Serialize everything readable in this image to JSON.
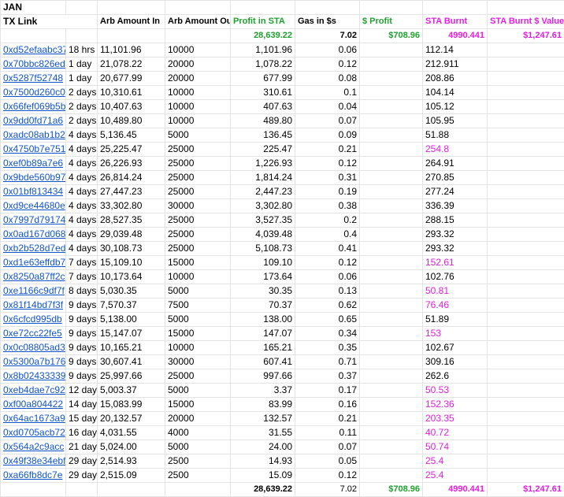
{
  "month": "JAN",
  "headers": {
    "tx_link": "TX Link",
    "arb_in": "Arb Amount In",
    "arb_out": "Arb Amount Out",
    "profit_sta": "Profit in STA",
    "gas": "Gas in $s",
    "profit_usd": "$ Profit",
    "sta_burnt": "STA Burnt",
    "sta_burnt_value": "STA Burnt $ Value"
  },
  "summary": {
    "profit_sta": "28,639.22",
    "gas": "7.02",
    "profit_usd": "$708.96",
    "sta_burnt": "4990.441",
    "sta_burnt_value": "$1,247.61"
  },
  "rows": [
    {
      "tx": "0xd52efaabc37",
      "age": "18 hrs",
      "in": "11,101.96",
      "out": "10000",
      "profit": "1,101.96",
      "gas": "0.06",
      "burnt": "112.14",
      "burnt_color": "black"
    },
    {
      "tx": "0x70bbc826ed",
      "age": "1 day",
      "in": "21,078.22",
      "out": "20000",
      "profit": "1,078.22",
      "gas": "0.12",
      "burnt": "212.911",
      "burnt_color": "black"
    },
    {
      "tx": "0x5287f52748",
      "age": "1 day",
      "in": "20,677.99",
      "out": "20000",
      "profit": "677.99",
      "gas": "0.08",
      "burnt": "208.86",
      "burnt_color": "black"
    },
    {
      "tx": "0x7500d260c0",
      "age": "2 days",
      "in": "10,310.61",
      "out": "10000",
      "profit": "310.61",
      "gas": "0.1",
      "burnt": "104.14",
      "burnt_color": "black"
    },
    {
      "tx": "0x66fef069b5b",
      "age": "2 days",
      "in": "10,407.63",
      "out": "10000",
      "profit": "407.63",
      "gas": "0.04",
      "burnt": "105.12",
      "burnt_color": "black"
    },
    {
      "tx": "0x9dd0fd71a6",
      "age": "2 days",
      "in": "10,489.80",
      "out": "10000",
      "profit": "489.80",
      "gas": "0.07",
      "burnt": "105.95",
      "burnt_color": "black"
    },
    {
      "tx": "0xadc08ab1b2",
      "age": "4 days",
      "in": "5,136.45",
      "out": "5000",
      "profit": "136.45",
      "gas": "0.09",
      "burnt": "51.88",
      "burnt_color": "black"
    },
    {
      "tx": "0x4750b7e751",
      "age": "4 days",
      "in": "25,225.47",
      "out": "25000",
      "profit": "225.47",
      "gas": "0.21",
      "burnt": "254.8",
      "burnt_color": "magenta"
    },
    {
      "tx": "0xef0b89a7e6",
      "age": "4 days",
      "in": "26,226.93",
      "out": "25000",
      "profit": "1,226.93",
      "gas": "0.12",
      "burnt": "264.91",
      "burnt_color": "black"
    },
    {
      "tx": "0x9bde560b97",
      "age": "4 days",
      "in": "26,814.24",
      "out": "25000",
      "profit": "1,814.24",
      "gas": "0.31",
      "burnt": "270.85",
      "burnt_color": "black"
    },
    {
      "tx": "0x01bf813434",
      "age": "4 days",
      "in": "27,447.23",
      "out": "25000",
      "profit": "2,447.23",
      "gas": "0.19",
      "burnt": "277.24",
      "burnt_color": "black"
    },
    {
      "tx": "0xd9ce44680e",
      "age": "4 days",
      "in": "33,302.80",
      "out": "30000",
      "profit": "3,302.80",
      "gas": "0.38",
      "burnt": "336.39",
      "burnt_color": "black"
    },
    {
      "tx": "0x7997d79174",
      "age": "4 days",
      "in": "28,527.35",
      "out": "25000",
      "profit": "3,527.35",
      "gas": "0.2",
      "burnt": "288.15",
      "burnt_color": "black"
    },
    {
      "tx": "0x0ad167d068",
      "age": "4 days",
      "in": "29,039.48",
      "out": "25000",
      "profit": "4,039.48",
      "gas": "0.4",
      "burnt": "293.32",
      "burnt_color": "black"
    },
    {
      "tx": "0xb2b528d7ed",
      "age": "4 days",
      "in": "30,108.73",
      "out": "25000",
      "profit": "5,108.73",
      "gas": "0.41",
      "burnt": "293.32",
      "burnt_color": "black"
    },
    {
      "tx": "0xd1e63effdb7",
      "age": "7 days",
      "in": "15,109.10",
      "out": "15000",
      "profit": "109.10",
      "gas": "0.12",
      "burnt": "152.61",
      "burnt_color": "magenta"
    },
    {
      "tx": "0x8250a87ff2c",
      "age": "7 days",
      "in": "10,173.64",
      "out": "10000",
      "profit": "173.64",
      "gas": "0.06",
      "burnt": "102.76",
      "burnt_color": "black"
    },
    {
      "tx": "0xe1166c9df7f",
      "age": "8 days",
      "in": "5,030.35",
      "out": "5000",
      "profit": "30.35",
      "gas": "0.13",
      "burnt": "50.81",
      "burnt_color": "magenta"
    },
    {
      "tx": "0x81f14bd7f3f",
      "age": "9 days",
      "in": "7,570.37",
      "out": "7500",
      "profit": "70.37",
      "gas": "0.62",
      "burnt": "76.46",
      "burnt_color": "magenta"
    },
    {
      "tx": "0x6cfcd995db",
      "age": "9 days",
      "in": "5,138.00",
      "out": "5000",
      "profit": "138.00",
      "gas": "0.65",
      "burnt": "51.89",
      "burnt_color": "black"
    },
    {
      "tx": "0xe72cc22fe5",
      "age": "9 days",
      "in": "15,147.07",
      "out": "15000",
      "profit": "147.07",
      "gas": "0.34",
      "burnt": "153",
      "burnt_color": "magenta"
    },
    {
      "tx": "0x0c08805ad3",
      "age": "9 days",
      "in": "10,165.21",
      "out": "10000",
      "profit": "165.21",
      "gas": "0.35",
      "burnt": "102.67",
      "burnt_color": "black"
    },
    {
      "tx": "0x5300a7b176",
      "age": "9 days",
      "in": "30,607.41",
      "out": "30000",
      "profit": "607.41",
      "gas": "0.71",
      "burnt": "309.16",
      "burnt_color": "black"
    },
    {
      "tx": "0x8b02433339",
      "age": "9 days",
      "in": "25,997.66",
      "out": "25000",
      "profit": "997.66",
      "gas": "0.37",
      "burnt": "262.6",
      "burnt_color": "black"
    },
    {
      "tx": "0xeb4dae7c92",
      "age": "12 day",
      "in": "5,003.37",
      "out": "5000",
      "profit": "3.37",
      "gas": "0.17",
      "burnt": "50.53",
      "burnt_color": "magenta"
    },
    {
      "tx": "0xf00a804422",
      "age": "14 day",
      "in": "15,083.99",
      "out": "15000",
      "profit": "83.99",
      "gas": "0.16",
      "burnt": "152.36",
      "burnt_color": "magenta"
    },
    {
      "tx": "0x64ac1673a9",
      "age": "15 day",
      "in": "20,132.57",
      "out": "20000",
      "profit": "132.57",
      "gas": "0.21",
      "burnt": "203.35",
      "burnt_color": "magenta"
    },
    {
      "tx": "0xd0705acb72",
      "age": "16 day",
      "in": "4,031.55",
      "out": "4000",
      "profit": "31.55",
      "gas": "0.11",
      "burnt": "40.72",
      "burnt_color": "magenta"
    },
    {
      "tx": "0x564a2c9acc",
      "age": "21 day",
      "in": "5,024.00",
      "out": "5000",
      "profit": "24.00",
      "gas": "0.07",
      "burnt": "50.74",
      "burnt_color": "magenta"
    },
    {
      "tx": "0x49f38e34ebf",
      "age": "29 day",
      "in": "2,514.93",
      "out": "2500",
      "profit": "14.93",
      "gas": "0.05",
      "burnt": "25.4",
      "burnt_color": "magenta"
    },
    {
      "tx": "0xa66fb8dc7e",
      "age": "29 day",
      "in": "2,515.09",
      "out": "2500",
      "profit": "15.09",
      "gas": "0.12",
      "burnt": "25.4",
      "burnt_color": "magenta"
    }
  ],
  "totals": {
    "profit_sta": "28,639.22",
    "gas": "7.02",
    "profit_usd": "$708.96",
    "sta_burnt": "4990.441",
    "sta_burnt_value": "$1,247.61"
  },
  "colors": {
    "green": "#1fa12e",
    "magenta": "#e31de3",
    "link": "#1155cc",
    "grid": "#e2e3e3"
  }
}
